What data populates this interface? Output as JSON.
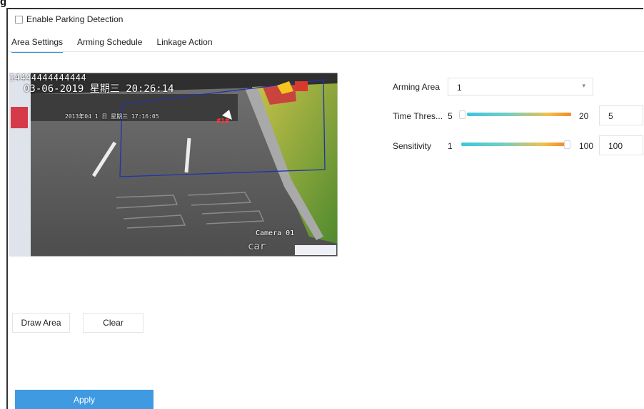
{
  "corner_letter": "g",
  "enable": {
    "label": "Enable Parking Detection",
    "checked": false
  },
  "tabs": [
    {
      "label": "Area Settings",
      "active": true
    },
    {
      "label": "Arming Schedule",
      "active": false
    },
    {
      "label": "Linkage Action",
      "active": false
    }
  ],
  "video": {
    "top_digits": "14444444444444",
    "datetime": "03-06-2019 星期三 20:26:14",
    "inner_datetime": "2013年04 1 日 星期三 17:16:05",
    "region_label": "#1#",
    "camera": "Camera 01",
    "car_text": "car"
  },
  "settings": {
    "arming_area": {
      "label": "Arming Area",
      "value": "1"
    },
    "time_threshold": {
      "label": "Time Thres...",
      "min": "5",
      "max": "20",
      "value": "5"
    },
    "sensitivity": {
      "label": "Sensitivity",
      "min": "1",
      "max": "100",
      "value": "100"
    }
  },
  "buttons": {
    "draw_area": "Draw Area",
    "clear": "Clear",
    "apply": "Apply"
  },
  "colors": {
    "accent": "#3f9ae2",
    "tab_underline": "#2f8cdb",
    "detection_line": "#2233aa"
  }
}
